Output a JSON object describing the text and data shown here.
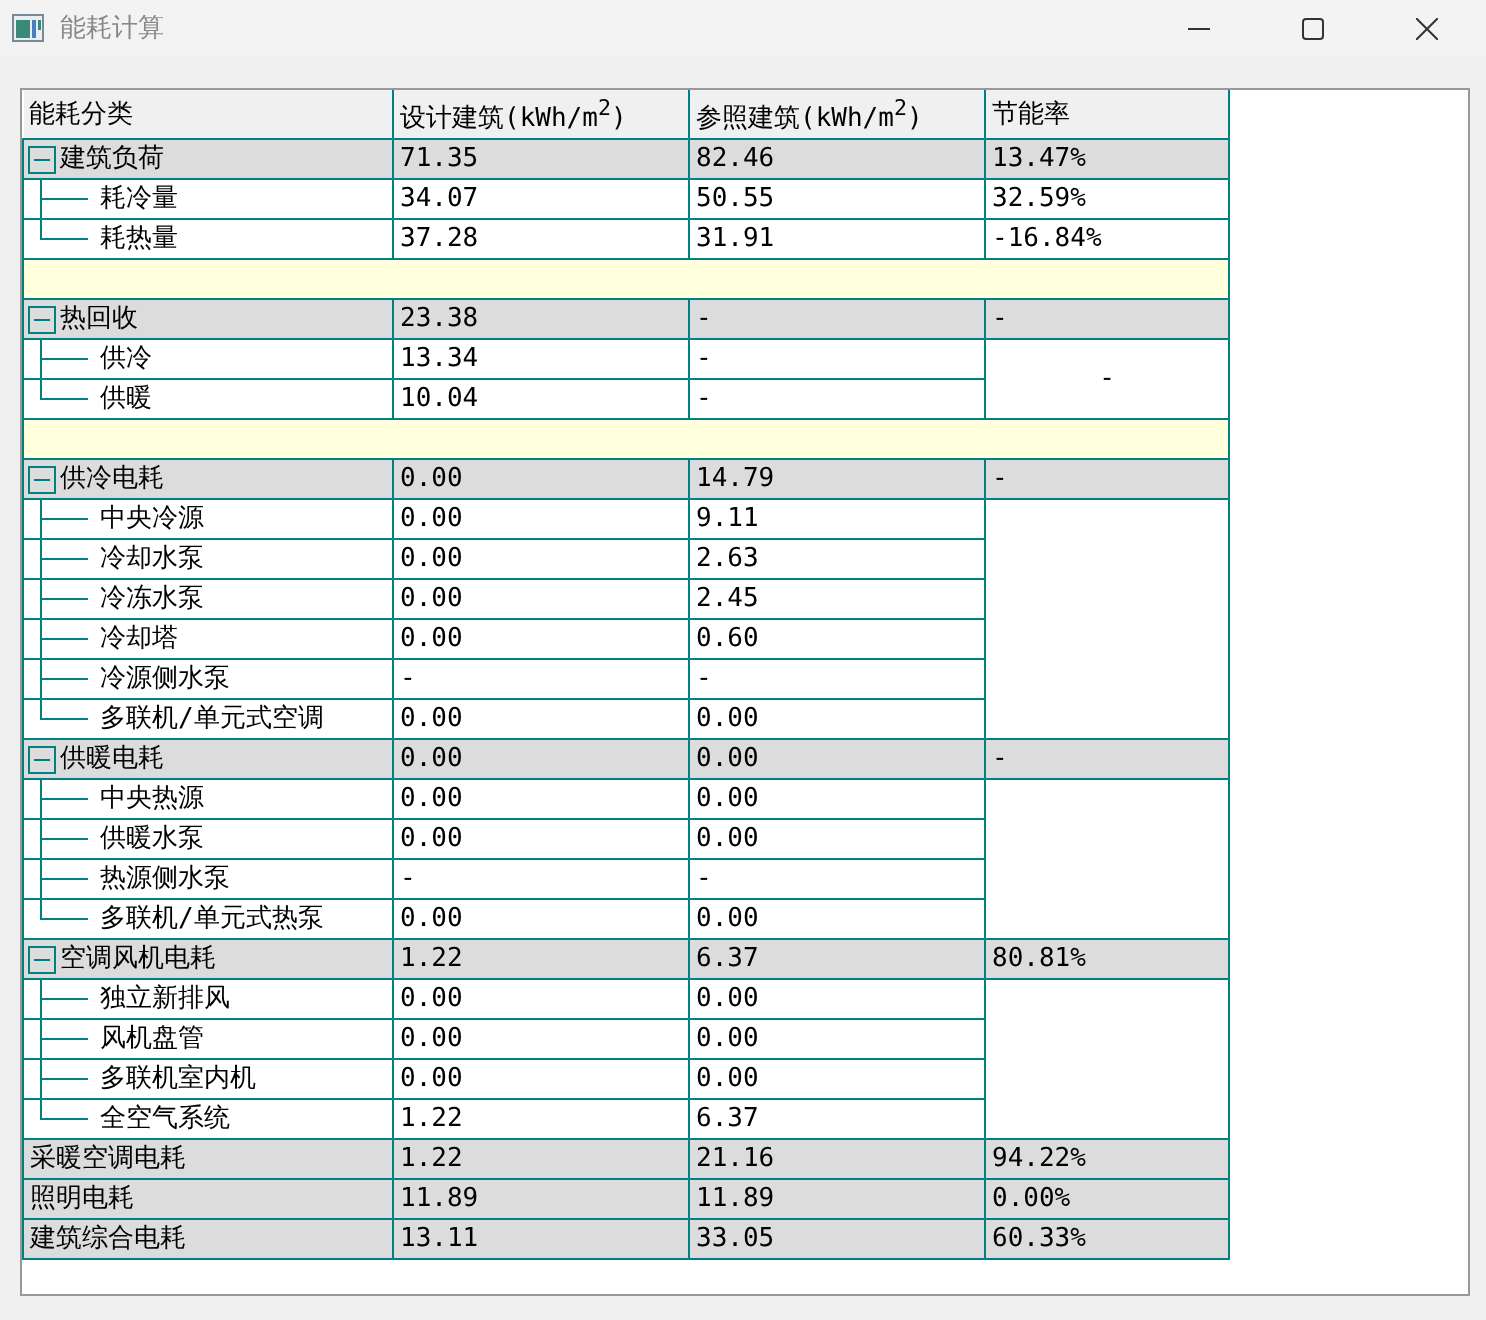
{
  "window": {
    "title": "能耗计算"
  },
  "columns": [
    "能耗分类",
    "设计建筑(kWh/m$^{2}$)",
    "参照建筑(kWh/m$^{2}$)",
    "节能率"
  ],
  "rows": [
    {
      "kind": "group",
      "label": "建筑负荷",
      "design": "71.35",
      "reference": "82.46",
      "rate": "13.47%",
      "expanded": true,
      "children": [
        {
          "label": "耗冷量",
          "design": "34.07",
          "reference": "50.55",
          "rate": "32.59%"
        },
        {
          "label": "耗热量",
          "design": "37.28",
          "reference": "31.91",
          "rate": "-16.84%"
        }
      ]
    },
    {
      "kind": "spacer"
    },
    {
      "kind": "group",
      "label": "热回收",
      "design": "23.38",
      "reference": "-",
      "rate": "-",
      "expanded": true,
      "children_rate": "-",
      "children": [
        {
          "label": "供冷",
          "design": "13.34",
          "reference": "-"
        },
        {
          "label": "供暖",
          "design": "10.04",
          "reference": "-"
        }
      ]
    },
    {
      "kind": "spacer"
    },
    {
      "kind": "group",
      "label": "供冷电耗",
      "design": "0.00",
      "reference": "14.79",
      "rate": "-",
      "expanded": true,
      "children": [
        {
          "label": "中央冷源",
          "design": "0.00",
          "reference": "9.11"
        },
        {
          "label": "冷却水泵",
          "design": "0.00",
          "reference": "2.63"
        },
        {
          "label": "冷冻水泵",
          "design": "0.00",
          "reference": "2.45"
        },
        {
          "label": "冷却塔",
          "design": "0.00",
          "reference": "0.60"
        },
        {
          "label": "冷源侧水泵",
          "design": "-",
          "reference": "-"
        },
        {
          "label": "多联机/单元式空调",
          "design": "0.00",
          "reference": "0.00"
        }
      ]
    },
    {
      "kind": "group",
      "label": "供暖电耗",
      "design": "0.00",
      "reference": "0.00",
      "rate": "-",
      "expanded": true,
      "children": [
        {
          "label": "中央热源",
          "design": "0.00",
          "reference": "0.00"
        },
        {
          "label": "供暖水泵",
          "design": "0.00",
          "reference": "0.00"
        },
        {
          "label": "热源侧水泵",
          "design": "-",
          "reference": "-"
        },
        {
          "label": "多联机/单元式热泵",
          "design": "0.00",
          "reference": "0.00"
        }
      ]
    },
    {
      "kind": "group",
      "label": "空调风机电耗",
      "design": "1.22",
      "reference": "6.37",
      "rate": "80.81%",
      "expanded": true,
      "children": [
        {
          "label": "独立新排风",
          "design": "0.00",
          "reference": "0.00"
        },
        {
          "label": "风机盘管",
          "design": "0.00",
          "reference": "0.00"
        },
        {
          "label": "多联机室内机",
          "design": "0.00",
          "reference": "0.00"
        },
        {
          "label": "全空气系统",
          "design": "1.22",
          "reference": "6.37"
        }
      ]
    },
    {
      "kind": "total",
      "label": "采暖空调电耗",
      "design": "1.22",
      "reference": "21.16",
      "rate": "94.22%"
    },
    {
      "kind": "total",
      "label": "照明电耗",
      "design": "11.89",
      "reference": "11.89",
      "rate": "0.00%"
    },
    {
      "kind": "total",
      "label": "建筑综合电耗",
      "design": "13.11",
      "reference": "33.05",
      "rate": "60.33%"
    }
  ]
}
